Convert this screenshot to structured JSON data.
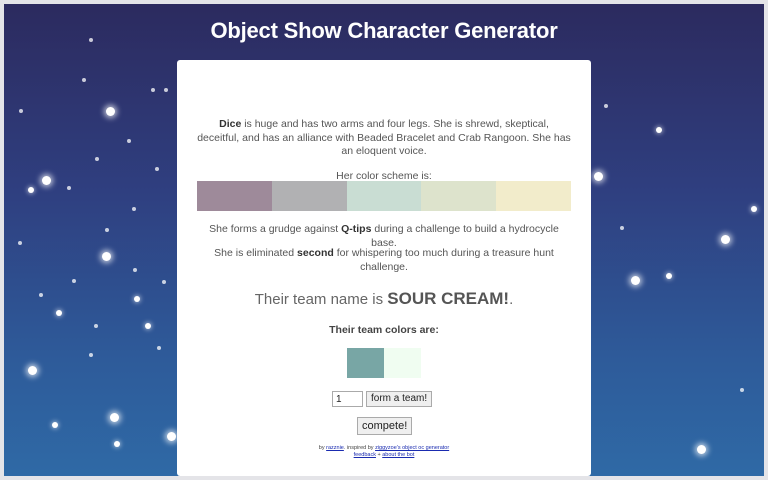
{
  "page": {
    "title": "Object Show Character Generator"
  },
  "character": {
    "name": "Dice",
    "description_1": " is huge and has two arms and four legs. She is shrewd, skeptical, deceitful, and has an alliance with Beaded Bracelet and Crab Rangoon. She has an eloquent voice.",
    "color_scheme_label": "Her color scheme is:",
    "color_scheme": [
      "#9e8a9a",
      "#b1b1b3",
      "#c9ddd3",
      "#dde3cc",
      "#f2eccb"
    ],
    "grudge_prefix": "She forms a grudge against ",
    "grudge_target": "Q-tips",
    "grudge_suffix": " during a challenge to build a hydrocycle base.",
    "elim_prefix": "She is eliminated ",
    "elim_place": "second",
    "elim_suffix": " for whispering too much during a treasure hunt challenge."
  },
  "team": {
    "name_prefix": "Their team name is ",
    "name": "SOUR CREAM!",
    "name_suffix": ".",
    "colors_label": "Their team colors are:",
    "colors": [
      "#78a6a5",
      "#f0fdf1"
    ]
  },
  "controls": {
    "team_count_value": "1",
    "form_team_label": "form a team!",
    "compete_label": "compete!"
  },
  "footer": {
    "by_text": "by ",
    "author": "razznie",
    "inspired_text": ". inspired by ",
    "inspired_link": "ziggyzoe's object oc generator",
    "feedback_link": "feedback",
    "separator": " + ",
    "about_link": "about the bot"
  }
}
